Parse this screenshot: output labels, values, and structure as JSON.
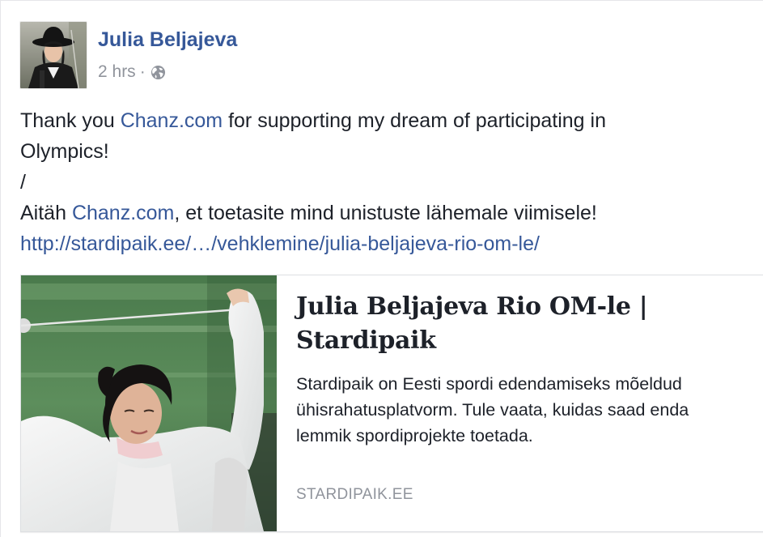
{
  "post": {
    "author": {
      "name": "Julia Beljajeva"
    },
    "meta": {
      "time": "2 hrs",
      "separator": "·",
      "privacy_icon": "globe-icon"
    },
    "text": {
      "line1_prefix": "Thank you ",
      "line1_link": "Chanz.com",
      "line1_suffix": " for supporting my dream of participating in",
      "line2": "Olympics!",
      "line3": "/",
      "line4_prefix": "Aitäh ",
      "line4_link": "Chanz.com",
      "line4_suffix": ", et toetasite mind unistuste lähemale viimisele!",
      "url": "http://stardipaik.ee/…/vehklemine/julia-beljajeva-rio-om-le/"
    },
    "link_preview": {
      "title_line1": "Julia Beljajeva Rio OM-le |",
      "title_line2": "Stardipaik",
      "description_line1": "Stardipaik on Eesti spordi edendamiseks mõeldud",
      "description_line2": "ühisrahatusplatvorm. Tule vaata, kuidas saad enda",
      "description_line3": "lemmik spordiprojekte toetada.",
      "domain": "STARDIPAIK.EE"
    }
  },
  "colors": {
    "link": "#365899",
    "text": "#1d2129",
    "meta": "#90949c",
    "border": "#dddfe2"
  }
}
